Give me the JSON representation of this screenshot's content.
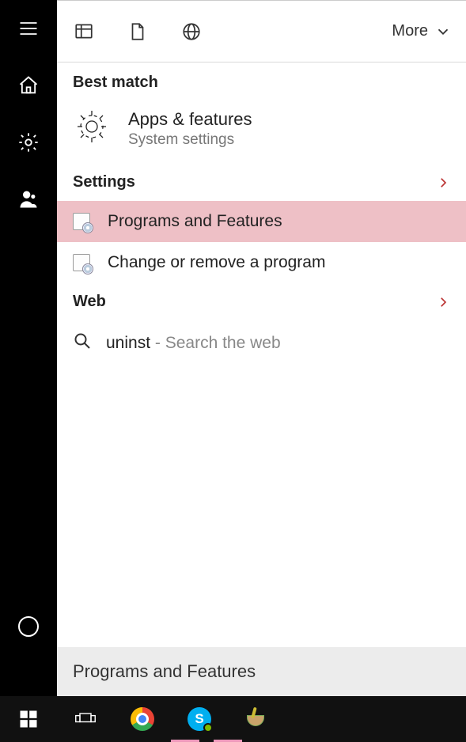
{
  "rail": {
    "items": [
      "menu",
      "home",
      "settings",
      "user"
    ],
    "cortana": "cortana-ring"
  },
  "filters": {
    "more_label": "More"
  },
  "sections": {
    "best_match": "Best match",
    "settings": "Settings",
    "web": "Web"
  },
  "best": {
    "title": "Apps & features",
    "subtitle": "System settings"
  },
  "results": {
    "programs_features": "Programs and Features",
    "change_remove": "Change or remove a program"
  },
  "web_result": {
    "query": "uninst",
    "hint": " - Search the web"
  },
  "search": {
    "value": "Programs and Features"
  },
  "selected_result": "programs_features",
  "taskbar": {
    "apps": [
      "start",
      "task-view",
      "chrome",
      "skype",
      "paint"
    ]
  }
}
